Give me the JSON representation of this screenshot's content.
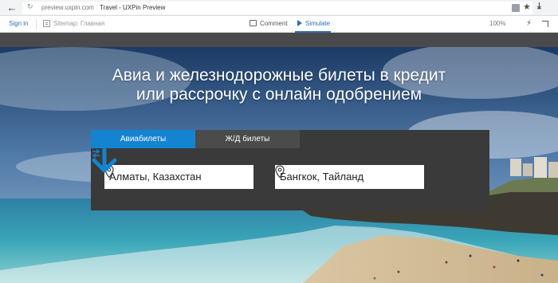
{
  "browser": {
    "url": "preview.uxpin.com",
    "page_title": "Travel - UXPin Preview",
    "icons": [
      "back-arrow-icon",
      "reload-icon",
      "extension-icon",
      "star-icon",
      "download-icon"
    ]
  },
  "toolbar": {
    "sign_in": "Sign in",
    "sitemap_label": "Sitemap:",
    "sitemap_page": "Главная",
    "comment": "Comment",
    "simulate": "Simulate",
    "zoom": "100%",
    "accent": "#2f6fb5",
    "icons": [
      "sitemap-icon",
      "comment-icon",
      "play-icon",
      "bolt-icon",
      "expand-icon"
    ]
  },
  "hero": {
    "headline_line1": "Авиа и железнодорожные билеты в кредит",
    "headline_line2": "или рассрочку с онлайн одобрением"
  },
  "search": {
    "tabs": [
      {
        "label": "Авиабилеты",
        "active": true
      },
      {
        "label": "Ж/Д билеты",
        "active": false
      }
    ],
    "from_value": "Алматы, Казахстан",
    "to_value": "Бангкок, Тайланд",
    "accent": "#1484d1",
    "panel_color": "#3a3a3a",
    "icons": [
      "location-pin-icon",
      "swap-arrows-icon",
      "arrow-down-icon"
    ]
  }
}
